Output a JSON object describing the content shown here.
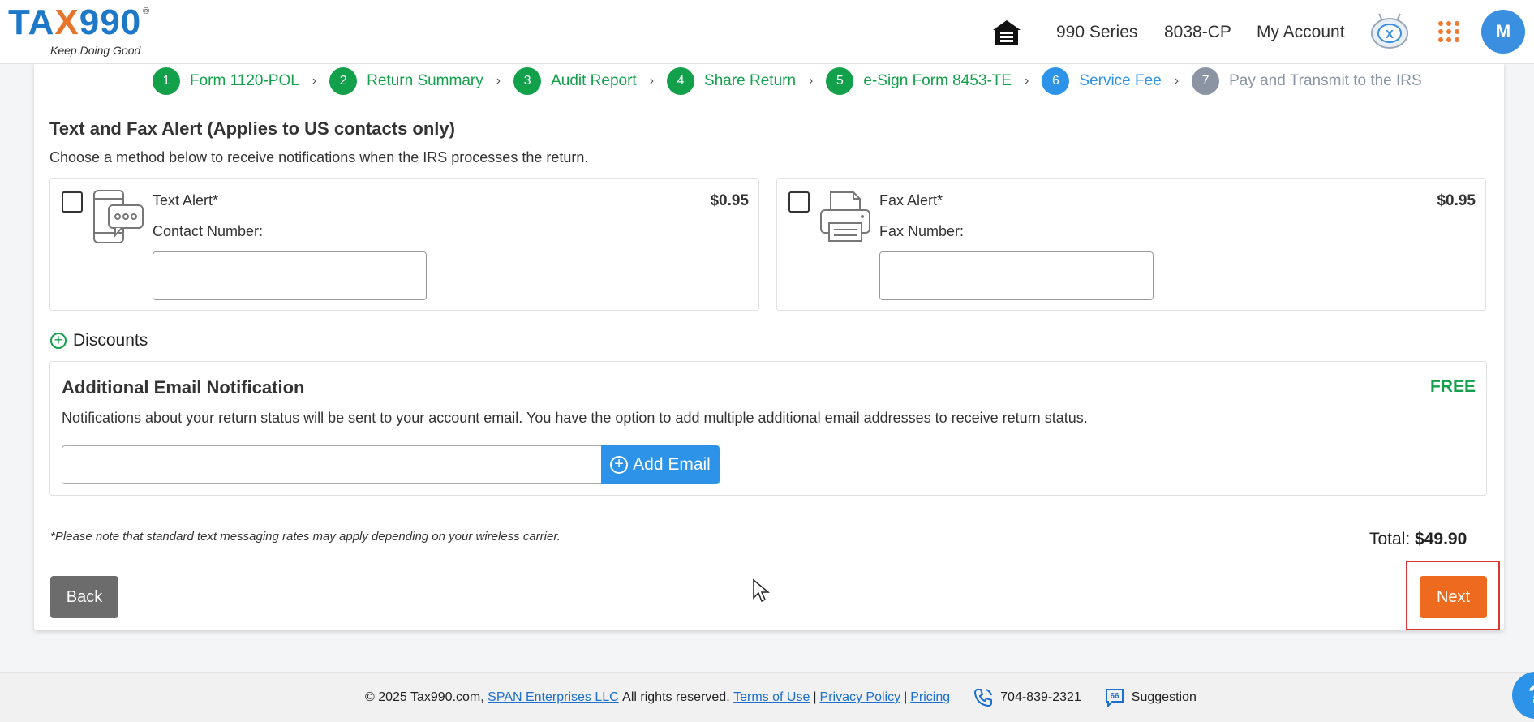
{
  "header": {
    "logo_text_a": "TA",
    "logo_text_x": "X",
    "logo_text_b": "990",
    "logo_registered": "®",
    "logo_tagline": "Keep Doing Good",
    "nav": [
      "990 Series",
      "8038-CP",
      "My Account"
    ],
    "avatar_initial": "M"
  },
  "stepper": [
    {
      "num": "1",
      "label": "Form 1120-POL",
      "state": "done"
    },
    {
      "num": "2",
      "label": "Return Summary",
      "state": "done"
    },
    {
      "num": "3",
      "label": "Audit Report",
      "state": "done"
    },
    {
      "num": "4",
      "label": "Share Return",
      "state": "done"
    },
    {
      "num": "5",
      "label": "e-Sign Form 8453-TE",
      "state": "done"
    },
    {
      "num": "6",
      "label": "Service Fee",
      "state": "active"
    },
    {
      "num": "7",
      "label": "Pay and Transmit to the IRS",
      "state": "todo"
    }
  ],
  "alerts": {
    "title": "Text and Fax Alert (Applies to US contacts only)",
    "description": "Choose a method below to receive notifications when the IRS processes the return.",
    "text": {
      "name": "Text Alert*",
      "price": "$0.95",
      "field_label": "Contact Number:",
      "value": ""
    },
    "fax": {
      "name": "Fax Alert*",
      "price": "$0.95",
      "field_label": "Fax Number:",
      "value": ""
    }
  },
  "discounts_label": "Discounts",
  "email": {
    "title": "Additional Email Notification",
    "price": "FREE",
    "description": "Notifications about your return status will be sent to your account email. You have the option to add multiple additional email addresses to receive return status.",
    "value": "",
    "add_label": "Add Email"
  },
  "note": "*Please note that standard text messaging rates may apply depending on your wireless carrier.",
  "total_label": "Total:",
  "total_value": "$49.90",
  "buttons": {
    "back": "Back",
    "next": "Next"
  },
  "footer": {
    "copyright": "© 2025 Tax990.com,",
    "company": "SPAN Enterprises LLC",
    "rights": "All rights reserved.",
    "terms": "Terms of Use",
    "privacy": "Privacy Policy",
    "pricing": "Pricing",
    "separator": "|",
    "phone": "704-839-2321",
    "suggestion": "Suggestion"
  },
  "help_label": "?",
  "colors": {
    "brand_blue": "#1e78c8",
    "brand_orange": "#e8742b",
    "step_done": "#12a14a",
    "step_active": "#2d93e8",
    "step_todo": "#8a94a3",
    "next_button": "#ee6a1f"
  }
}
